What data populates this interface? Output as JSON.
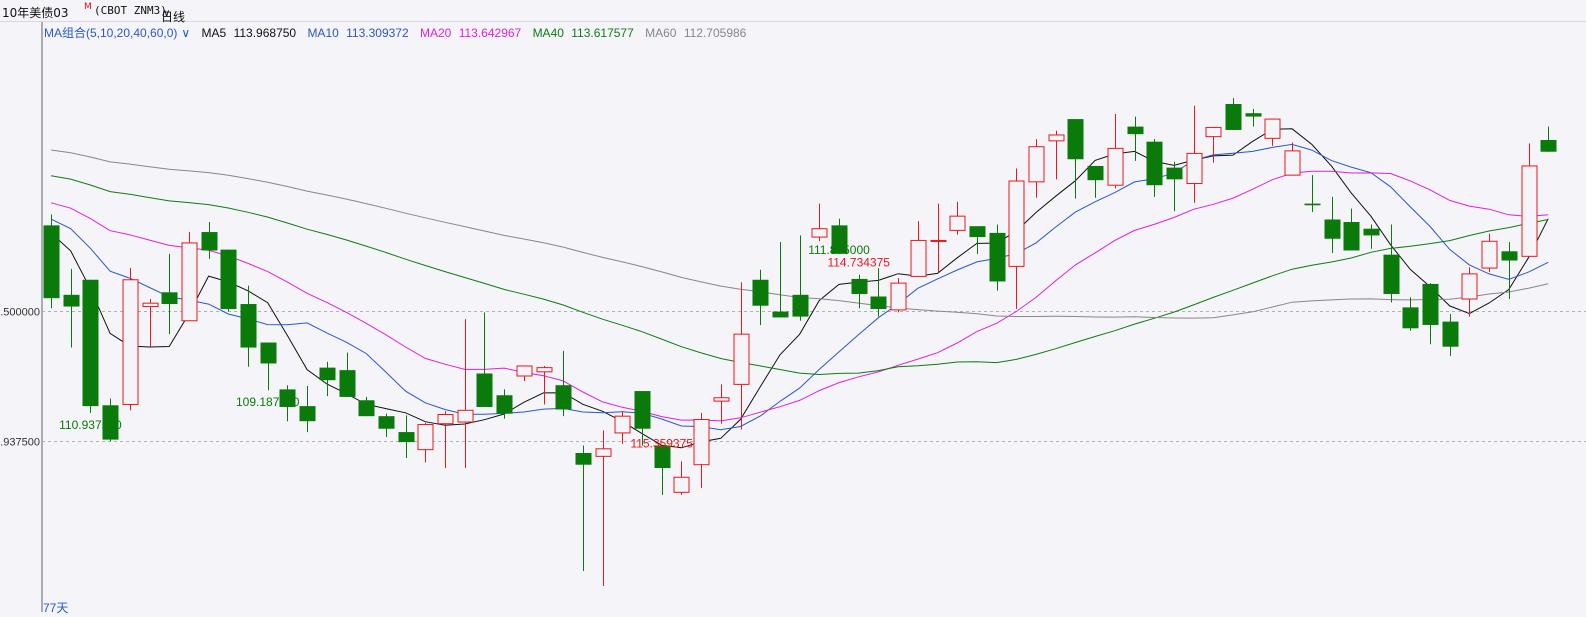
{
  "header": {
    "title": "10年美债03",
    "title_mark": "M",
    "code": "(CBOT ZNM3)",
    "period": "日线"
  },
  "legend": {
    "combo": "MA组合(5,10,20,40,60,0)",
    "items": [
      {
        "name": "MA5",
        "value": "113.968750",
        "color": "#111111"
      },
      {
        "name": "MA10",
        "value": "113.309372",
        "color": "#2a58c8"
      },
      {
        "name": "MA20",
        "value": "113.642967",
        "color": "#e020d8"
      },
      {
        "name": "MA40",
        "value": "113.617577",
        "color": "#107c10"
      },
      {
        "name": "MA60",
        "value": "112.705986",
        "color": "#888888"
      }
    ]
  },
  "colors": {
    "up": "#e8181c",
    "down": "#0a7a0a",
    "grid": "#b0b0b8",
    "axis": "#606070"
  },
  "chart_data": {
    "type": "candlestick",
    "ylim": [
      108.9,
      115.95
    ],
    "yticks": [
      {
        "value": 112.5,
        "label": ".500000"
      },
      {
        "value": 110.9375,
        "label": ".937500"
      }
    ],
    "bottom_label": "77天",
    "grid": "horizontal-dashed",
    "annotations": [
      {
        "label": "115.359375",
        "index": 31,
        "at": "high",
        "color": "#e8181c"
      },
      {
        "label": "114.734375",
        "index": 41,
        "at": "high",
        "color": "#e8181c"
      },
      {
        "label": "111.875000",
        "index": 40,
        "at": "low",
        "color": "#0a7a0a"
      },
      {
        "label": "110.937500",
        "index": 2,
        "at": "low",
        "color": "#0a7a0a"
      },
      {
        "label": "109.187500",
        "index": 11,
        "at": "low",
        "color": "#0a7a0a"
      }
    ],
    "candles": [
      [
        13.52,
        12.65,
        13.65,
        12.53
      ],
      [
        12.69,
        12.55,
        13.0,
        12.06
      ],
      [
        12.87,
        11.36,
        12.87,
        11.28
      ],
      [
        11.37,
        10.96,
        11.45,
        10.94
      ],
      [
        11.38,
        12.87,
        13.01,
        11.31
      ],
      [
        12.55,
        12.59,
        12.64,
        12.07
      ],
      [
        12.72,
        12.58,
        13.18,
        12.22
      ],
      [
        12.38,
        13.31,
        13.44,
        12.38
      ],
      [
        13.44,
        13.22,
        13.56,
        13.12
      ],
      [
        13.23,
        12.52,
        13.23,
        12.49
      ],
      [
        12.58,
        12.06,
        12.8,
        11.83
      ],
      [
        12.12,
        11.87,
        12.12,
        11.55
      ],
      [
        11.56,
        11.35,
        11.61,
        11.18
      ],
      [
        11.36,
        11.18,
        11.6,
        11.05
      ],
      [
        11.82,
        11.67,
        11.89,
        11.48
      ],
      [
        11.79,
        11.47,
        12.0,
        11.53
      ],
      [
        11.43,
        11.24,
        11.47,
        11.34
      ],
      [
        11.24,
        11.09,
        11.27,
        10.99
      ],
      [
        11.05,
        10.93,
        11.25,
        10.74
      ],
      [
        10.84,
        11.14,
        11.16,
        10.69
      ],
      [
        11.15,
        11.26,
        11.3,
        10.62
      ],
      [
        11.17,
        11.31,
        12.4,
        10.62
      ],
      [
        11.75,
        11.35,
        12.48,
        11.41
      ],
      [
        11.49,
        11.27,
        11.56,
        11.21
      ],
      [
        11.72,
        11.84,
        11.75,
        11.66
      ],
      [
        11.77,
        11.82,
        11.84,
        11.38
      ],
      [
        11.61,
        11.32,
        12.02,
        11.24
      ],
      [
        10.8,
        10.66,
        10.89,
        9.39
      ],
      [
        10.76,
        10.85,
        11.07,
        9.21
      ],
      [
        11.04,
        11.24,
        11.3,
        10.91
      ],
      [
        11.54,
        11.09,
        11.38,
        10.89
      ],
      [
        10.89,
        10.62,
        10.77,
        10.3
      ],
      [
        10.33,
        10.51,
        10.7,
        10.3
      ],
      [
        10.66,
        11.2,
        11.28,
        10.38
      ],
      [
        11.42,
        11.46,
        11.62,
        11.15
      ],
      [
        11.62,
        12.22,
        12.84,
        11.08
      ],
      [
        12.87,
        12.56,
        12.99,
        12.33
      ],
      [
        12.49,
        12.42,
        13.32,
        12.51
      ],
      [
        12.69,
        12.43,
        13.4,
        12.38
      ],
      [
        13.38,
        13.48,
        13.78,
        13.33
      ],
      [
        13.52,
        13.18,
        13.6,
        13.37
      ],
      [
        12.88,
        12.7,
        12.93,
        12.53
      ],
      [
        12.67,
        12.52,
        13.01,
        12.43
      ],
      [
        12.51,
        12.83,
        12.89,
        12.48
      ],
      [
        12.91,
        13.34,
        13.57,
        12.91
      ],
      [
        13.33,
        13.34,
        13.78,
        12.96
      ],
      [
        13.46,
        13.63,
        13.8,
        13.41
      ],
      [
        13.51,
        13.38,
        13.5,
        13.18
      ],
      [
        13.43,
        12.85,
        13.53,
        12.74
      ],
      [
        13.03,
        14.05,
        14.2,
        12.52
      ],
      [
        14.04,
        14.46,
        14.55,
        13.85
      ],
      [
        14.53,
        14.6,
        14.65,
        14.07
      ],
      [
        14.79,
        14.31,
        14.39,
        13.84
      ],
      [
        14.23,
        14.06,
        14.19,
        13.85
      ],
      [
        14.0,
        14.44,
        14.85,
        13.96
      ],
      [
        14.7,
        14.61,
        14.82,
        14.29
      ],
      [
        14.52,
        14.0,
        14.55,
        13.86
      ],
      [
        14.21,
        14.07,
        14.28,
        13.69
      ],
      [
        14.02,
        14.38,
        14.95,
        13.79
      ],
      [
        14.58,
        14.69,
        14.67,
        14.27
      ],
      [
        14.97,
        14.66,
        15.04,
        14.84
      ],
      [
        14.86,
        14.82,
        14.91,
        14.7
      ],
      [
        14.56,
        14.79,
        14.51,
        14.47
      ],
      [
        14.12,
        14.41,
        14.51,
        14.15
      ],
      [
        13.78,
        13.76,
        14.12,
        13.68
      ],
      [
        13.59,
        13.36,
        13.86,
        13.19
      ],
      [
        13.56,
        13.22,
        13.72,
        13.32
      ],
      [
        13.48,
        13.4,
        13.53,
        13.24
      ],
      [
        13.17,
        12.7,
        13.53,
        12.6
      ],
      [
        12.54,
        12.29,
        12.66,
        12.26
      ],
      [
        12.82,
        12.33,
        12.83,
        12.1
      ],
      [
        12.37,
        12.07,
        12.46,
        11.96
      ],
      [
        12.64,
        12.94,
        13.02,
        12.43
      ],
      [
        13.01,
        13.33,
        13.42,
        12.96
      ],
      [
        13.21,
        13.1,
        13.32,
        12.64
      ],
      [
        13.15,
        14.23,
        14.5,
        13.22
      ],
      [
        14.54,
        14.4,
        14.7,
        14.49
      ]
    ]
  }
}
